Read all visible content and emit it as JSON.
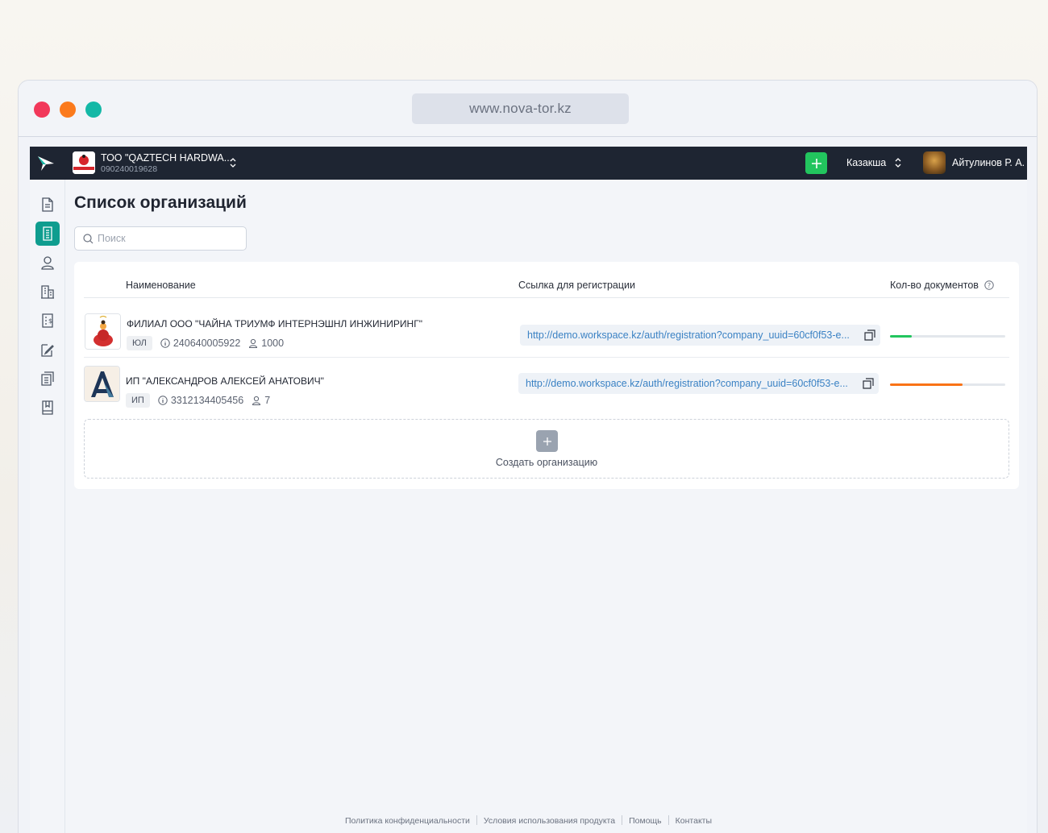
{
  "browser": {
    "url": "www.nova-tor.kz"
  },
  "topnav": {
    "org_name": "ТОО \"QAZTECH HARDWA...",
    "org_id": "090240019628",
    "city": "Казакша",
    "user_name": "Айтулинов Р. А."
  },
  "sidebar": {
    "items": [
      {
        "icon": "document-icon",
        "active": false
      },
      {
        "icon": "building-list-icon",
        "active": true
      },
      {
        "icon": "user-icon",
        "active": false
      },
      {
        "icon": "office-icon",
        "active": false
      },
      {
        "icon": "invoice-icon",
        "active": false
      },
      {
        "icon": "edit-document-icon",
        "active": false
      },
      {
        "icon": "documents-icon",
        "active": false
      },
      {
        "icon": "book-icon",
        "active": false
      }
    ]
  },
  "page": {
    "title": "Список организаций",
    "search_placeholder": "Поиск"
  },
  "table": {
    "columns": [
      "Наименование",
      "Ссылка для регистрации",
      "Кол-во документов"
    ],
    "rows": [
      {
        "name": "ФИЛИАЛ ООО \"ЧАЙНА ТРИУМФ ИНТЕРНЭШНЛ ИНЖИНИРИНГ\"",
        "type": "ЮЛ",
        "id": "240640005922",
        "users": "1000",
        "link": "http://demo.workspace.kz/auth/registration?company_uuid=60cf0f53-e...",
        "doc_fill": 0.19,
        "bar_color": "#22c55e"
      },
      {
        "name": "ИП \"АЛЕКСАНДРОВ АЛЕКСЕЙ АНАТОВИЧ\"",
        "type": "ИП",
        "id": "3312134405456",
        "users": "7",
        "link": "http://demo.workspace.kz/auth/registration?company_uuid=60cf0f53-e...",
        "doc_fill": 0.63,
        "bar_color": "#f97316"
      }
    ],
    "create_label": "Создать организацию"
  },
  "footer": {
    "links": [
      "Политика конфиденциальности",
      "Условия использования продукта",
      "Помощь",
      "Контакты"
    ]
  },
  "colors": {
    "accent": "#0f9d8f",
    "nav_bg": "#1e2532",
    "add_green": "#22c55e"
  }
}
